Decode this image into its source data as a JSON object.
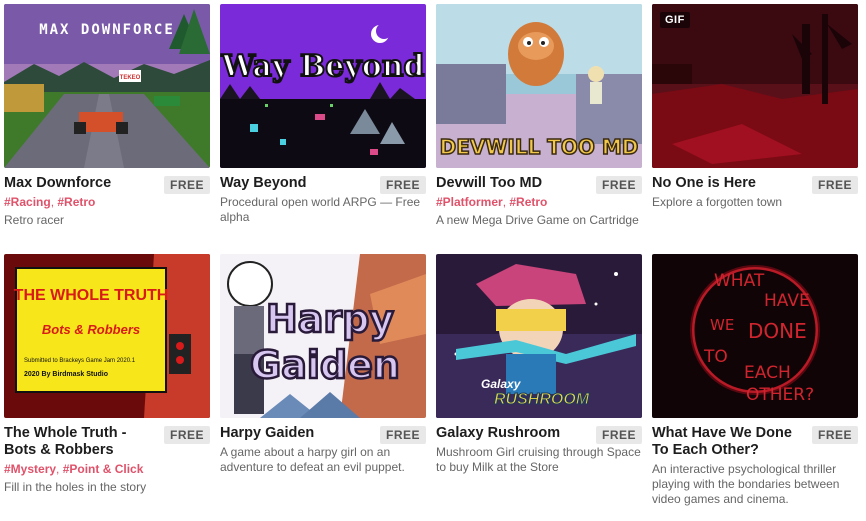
{
  "games": [
    {
      "title": "Max Downforce",
      "price": "FREE",
      "tags": [
        "#Racing",
        "#Retro"
      ],
      "description": "Retro racer",
      "thumb_text": "MAX DOWNFORCE",
      "gif": null
    },
    {
      "title": "Way Beyond",
      "price": "FREE",
      "tags": [],
      "description": "Procedural open world ARPG — Free alpha",
      "thumb_text": "Way Beyond",
      "gif": null
    },
    {
      "title": "Devwill Too MD",
      "price": "FREE",
      "tags": [
        "#Platformer",
        "#Retro"
      ],
      "description": "A new Mega Drive Game on Cartridge",
      "thumb_text": "DEVWILL TOO MD",
      "gif": null
    },
    {
      "title": "No One is Here",
      "price": "FREE",
      "tags": [],
      "description": "Explore a forgotten town",
      "thumb_text": "",
      "gif": "GIF"
    },
    {
      "title": "The Whole Truth - Bots & Robbers",
      "price": "FREE",
      "tags": [
        "#Mystery",
        "#Point & Click"
      ],
      "description": "Fill in the holes in the story",
      "thumb_text": "THE WHOLE TRUTH",
      "thumb_sub": "Bots & Robbers",
      "thumb_note1": "Submitted to Brackeys Game Jam 2020.1",
      "thumb_note2": "2020 By Birdmask Studio",
      "gif": null
    },
    {
      "title": "Harpy Gaiden",
      "price": "FREE",
      "tags": [],
      "description": "A game about a harpy girl on an adventure to defeat an evil puppet.",
      "thumb_text": "Harpy",
      "thumb_text2": "Gaiden",
      "gif": null
    },
    {
      "title": "Galaxy Rushroom",
      "price": "FREE",
      "tags": [],
      "description": "Mushroom Girl cruising through Space to buy Milk at the Store",
      "thumb_text": "Galaxy",
      "thumb_text2": "RUSHROOM",
      "gif": null
    },
    {
      "title": "What Have We Done To Each Other?",
      "price": "FREE",
      "tags": [],
      "description": "An interactive psychological thriller playing with the bondaries between video games and cinema.",
      "thumb_words": [
        "WHAT",
        "HAVE",
        "WE",
        "DONE",
        "TO",
        "EACH",
        "OTHER?"
      ],
      "gif": null
    }
  ]
}
